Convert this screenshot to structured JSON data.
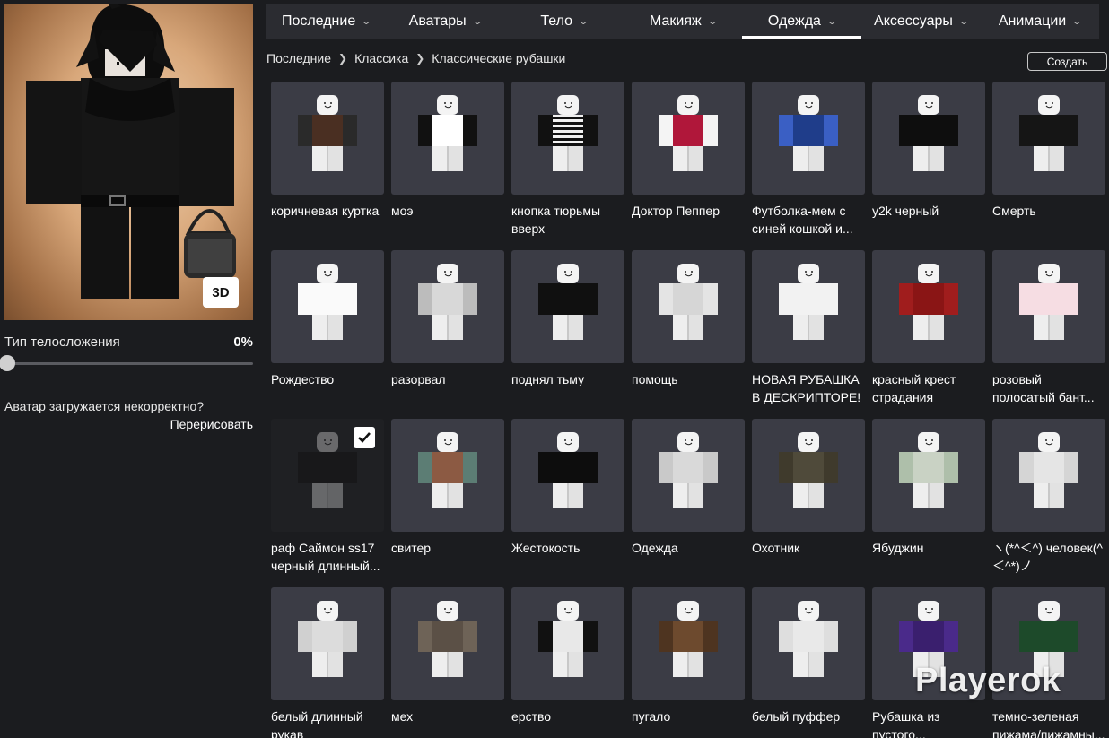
{
  "tabs": [
    {
      "label": "Последние",
      "active": false
    },
    {
      "label": "Аватары",
      "active": false
    },
    {
      "label": "Тело",
      "active": false
    },
    {
      "label": "Макияж",
      "active": false
    },
    {
      "label": "Одежда",
      "active": true
    },
    {
      "label": "Аксессуары",
      "active": false
    },
    {
      "label": "Анимации",
      "active": false
    }
  ],
  "breadcrumb": [
    "Последние",
    "Классика",
    "Классические рубашки"
  ],
  "create_button": "Создать",
  "avatar_panel": {
    "view_3d_label": "3D",
    "body_type_label": "Тип телосложения",
    "body_type_value": "0%",
    "body_type_fraction": 0,
    "warning": "Аватар загружается некорректно?",
    "redraw_link": "Перерисовать"
  },
  "items": [
    {
      "name": "коричневая куртка",
      "colors": [
        "#4a2f22",
        "#2a2a2a"
      ],
      "selected": false
    },
    {
      "name": "моэ",
      "colors": [
        "#ffffff",
        "#111111"
      ],
      "selected": false
    },
    {
      "name": "кнопка тюрьмы вверх",
      "colors": [
        "#f0f0f0",
        "#111111"
      ],
      "pattern": "stripes",
      "selected": false
    },
    {
      "name": "Доктор Пеппер",
      "colors": [
        "#b0173a",
        "#f4f4f4"
      ],
      "selected": false
    },
    {
      "name": "Футболка-мем с синей кошкой и...",
      "colors": [
        "#1f3d8a",
        "#3a5fc4"
      ],
      "selected": false
    },
    {
      "name": "y2k черный",
      "colors": [
        "#0e0e0e",
        "#0e0e0e"
      ],
      "selected": false
    },
    {
      "name": "Смерть",
      "colors": [
        "#151515",
        "#151515"
      ],
      "selected": false
    },
    {
      "name": "Рождество",
      "colors": [
        "#fafafa",
        "#fafafa"
      ],
      "selected": false
    },
    {
      "name": "разорвал",
      "colors": [
        "#d8d8d8",
        "#bcbcbc"
      ],
      "selected": false
    },
    {
      "name": "поднял тьму",
      "colors": [
        "#101010",
        "#101010"
      ],
      "selected": false
    },
    {
      "name": "помощь",
      "colors": [
        "#d6d6d6",
        "#e4e4e4"
      ],
      "selected": false
    },
    {
      "name": "НОВАЯ РУБАШКА В ДЕСКРИПТОРЕ!",
      "colors": [
        "#f2f2f2",
        "#f2f2f2"
      ],
      "selected": false
    },
    {
      "name": "красный крест страдания",
      "colors": [
        "#8a1515",
        "#a01d1d"
      ],
      "selected": false
    },
    {
      "name": "розовый полосатый бант...",
      "colors": [
        "#f6dde3",
        "#f6dde3"
      ],
      "selected": false
    },
    {
      "name": "раф Саймон ss17 черный длинный...",
      "colors": [
        "#0c0c0c",
        "#0c0c0c"
      ],
      "selected": true
    },
    {
      "name": "свитер",
      "colors": [
        "#8c5a43",
        "#5c7d74"
      ],
      "selected": false
    },
    {
      "name": "Жестокость",
      "colors": [
        "#0d0d0d",
        "#0d0d0d"
      ],
      "selected": false
    },
    {
      "name": "Одежда",
      "colors": [
        "#d9d9d9",
        "#c9c9c9"
      ],
      "selected": false
    },
    {
      "name": "Охотник",
      "colors": [
        "#4f4a3a",
        "#3f3a2c"
      ],
      "selected": false
    },
    {
      "name": "Ябуджин",
      "colors": [
        "#c9d2c4",
        "#aebfaa"
      ],
      "selected": false
    },
    {
      "name": "ヽ(*^＜^) человек(^＜^*)ノ",
      "colors": [
        "#e5e5e5",
        "#d5d5d5"
      ],
      "selected": false
    },
    {
      "name": "белый длинный рукав",
      "colors": [
        "#dcdcdc",
        "#d0d0d0"
      ],
      "selected": false
    },
    {
      "name": "мех",
      "colors": [
        "#5b5046",
        "#6e6357"
      ],
      "selected": false
    },
    {
      "name": "ерство",
      "colors": [
        "#e8e8e8",
        "#111111"
      ],
      "selected": false
    },
    {
      "name": "пугало",
      "colors": [
        "#6d4a2e",
        "#4e3420"
      ],
      "selected": false
    },
    {
      "name": "белый пуффер",
      "colors": [
        "#e9e9e9",
        "#dedede"
      ],
      "selected": false
    },
    {
      "name": "Рубашка из пустого...",
      "colors": [
        "#3a1f6e",
        "#4a2a8a"
      ],
      "selected": false
    },
    {
      "name": "темно-зеленая пижама/пижамны...",
      "colors": [
        "#1d4a2a",
        "#1d4a2a"
      ],
      "selected": false
    }
  ],
  "watermark": "Playerok"
}
